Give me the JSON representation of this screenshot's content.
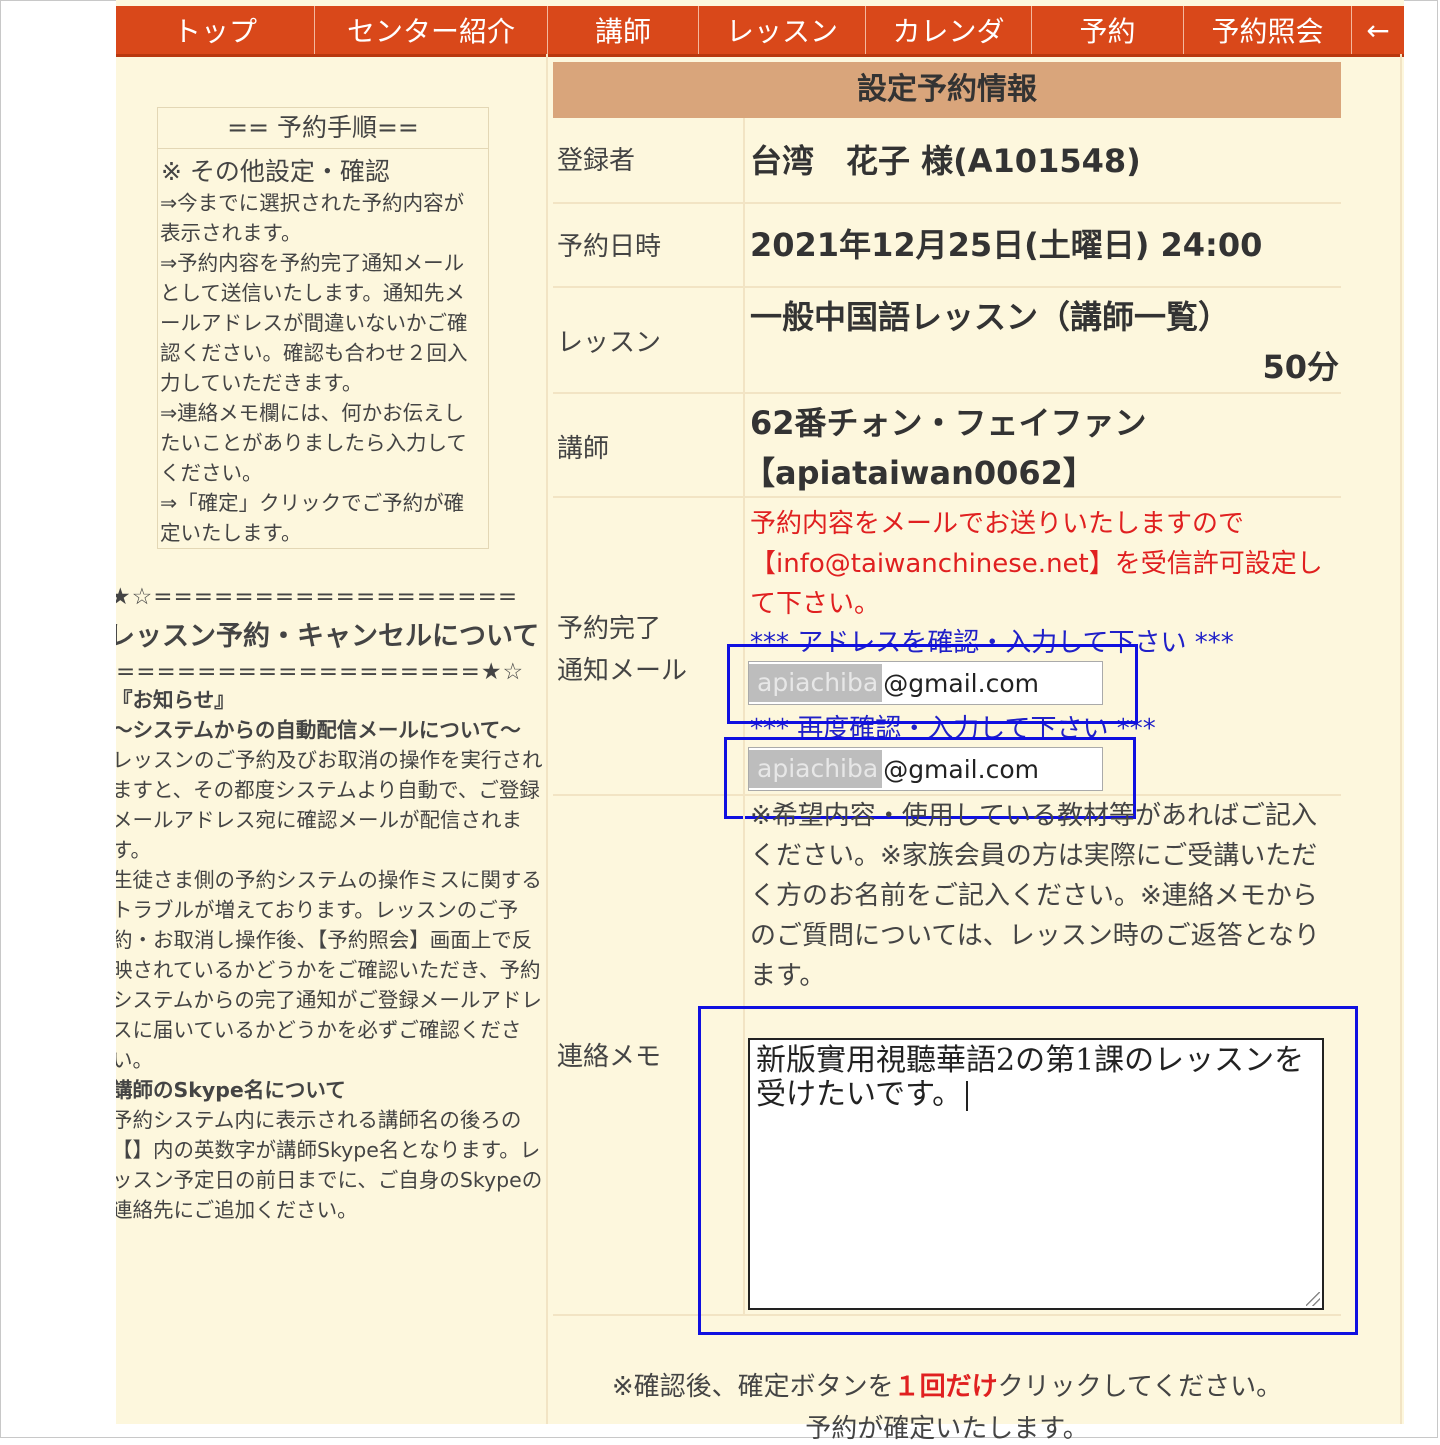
{
  "nav": [
    "トップ",
    "センター紹介",
    "講師",
    "レッスン",
    "カレンダ",
    "予約",
    "予約照会",
    "←"
  ],
  "steps": {
    "title": "== 予約手順==",
    "subtitle": "※ その他設定・確認",
    "lines": [
      "⇒今までに選択された予約内容が",
      "表示されます。",
      "⇒予約内容を予約完了通知メール",
      "として送信いたします。通知先メ",
      "ールアドレスが間違いないかご確",
      "認ください。確認も合わせ２回入",
      "力していただきます。",
      "⇒連絡メモ欄には、何かお伝えし",
      "たいことがありましたら入力して",
      "ください。",
      "⇒「確定」クリックでご予約が確",
      "定いたします。"
    ]
  },
  "news": {
    "stars_top": "★☆==================",
    "heading": "レッスン予約・キャンセルについて",
    "stars_bottom": "==================★☆",
    "lines": [
      {
        "text": "『お知らせ』",
        "bold": true
      },
      {
        "text": "～システムからの自動配信メールについて～",
        "bold": true
      },
      {
        "text": "レッスンのご予約及びお取消の操作を実行され",
        "bold": false
      },
      {
        "text": "ますと、その都度システムより自動で、ご登録",
        "bold": false
      },
      {
        "text": "メールアドレス宛に確認メールが配信されま",
        "bold": false
      },
      {
        "text": "す。",
        "bold": false
      },
      {
        "text": "生徒さま側の予約システムの操作ミスに関する",
        "bold": false
      },
      {
        "text": "トラブルが増えております。レッスンのご予",
        "bold": false
      },
      {
        "text": "約・お取消し操作後、【予約照会】画面上で反",
        "bold": false
      },
      {
        "text": "映されているかどうかをご確認いただき、予約",
        "bold": false
      },
      {
        "text": "システムからの完了通知がご登録メールアドレ",
        "bold": false
      },
      {
        "text": "スに届いているかどうかを必ずご確認くださ",
        "bold": false
      },
      {
        "text": "い。",
        "bold": false
      },
      {
        "text": "講師のSkype名について",
        "bold": true
      },
      {
        "text": "予約システム内に表示される講師名の後ろの",
        "bold": false
      },
      {
        "text": "【】内の英数字が講師Skype名となります。レ",
        "bold": false
      },
      {
        "text": "ッスン予定日の前日までに、ご自身のSkypeの",
        "bold": false
      },
      {
        "text": "連絡先にご追加ください。",
        "bold": false
      }
    ]
  },
  "info": {
    "header": "設定予約情報",
    "registrant_label": "登録者",
    "registrant_value": "台湾　花子 様(A101548)",
    "datetime_label": "予約日時",
    "datetime_value": "2021年12月25日(土曜日) 24:00",
    "lesson_label": "レッスン",
    "lesson_value": "一般中国語レッスン（講師一覧）",
    "lesson_duration": "50分",
    "teacher_label": "講師",
    "teacher_name": "62番チォン・フェイファン",
    "teacher_skype": "【apiataiwan0062】",
    "mail_label_1": "予約完了",
    "mail_label_2": "通知メール",
    "mail_note": "予約内容をメールでお送りいたしますので【info@taiwanchinese.net】を受信許可設定して下さい。",
    "address_prompt": "*** アドレスを確認・入力して下さい ***",
    "reconfirm_prompt": "*** 再度確認・入力して下さい ***",
    "email_masked": "apiachiba",
    "email_domain": "@gmail.com",
    "memo_label": "連絡メモ",
    "memo_note": "※希望内容・使用している教材等があればご記入ください。※家族会員の方は実際にご受講いただく方のお名前をご記入ください。※連絡メモからのご質問については、レッスン時のご返答となります。",
    "memo_value": "新版實用視聽華語2の第1課のレッスンを受けたいです。",
    "confirm_pre": "※確認後、確定ボタンを",
    "confirm_em": "１回だけ",
    "confirm_post": "クリックしてください。",
    "confirm_line2": "予約が確定いたします。"
  },
  "colors": {
    "nav_bg": "#d9481a",
    "page_bg": "#fdf7dd",
    "table_header_bg": "#d9a57b",
    "alert_red": "#e02020",
    "prompt_blue": "#2020c8",
    "highlight_blue": "#1010e0"
  }
}
